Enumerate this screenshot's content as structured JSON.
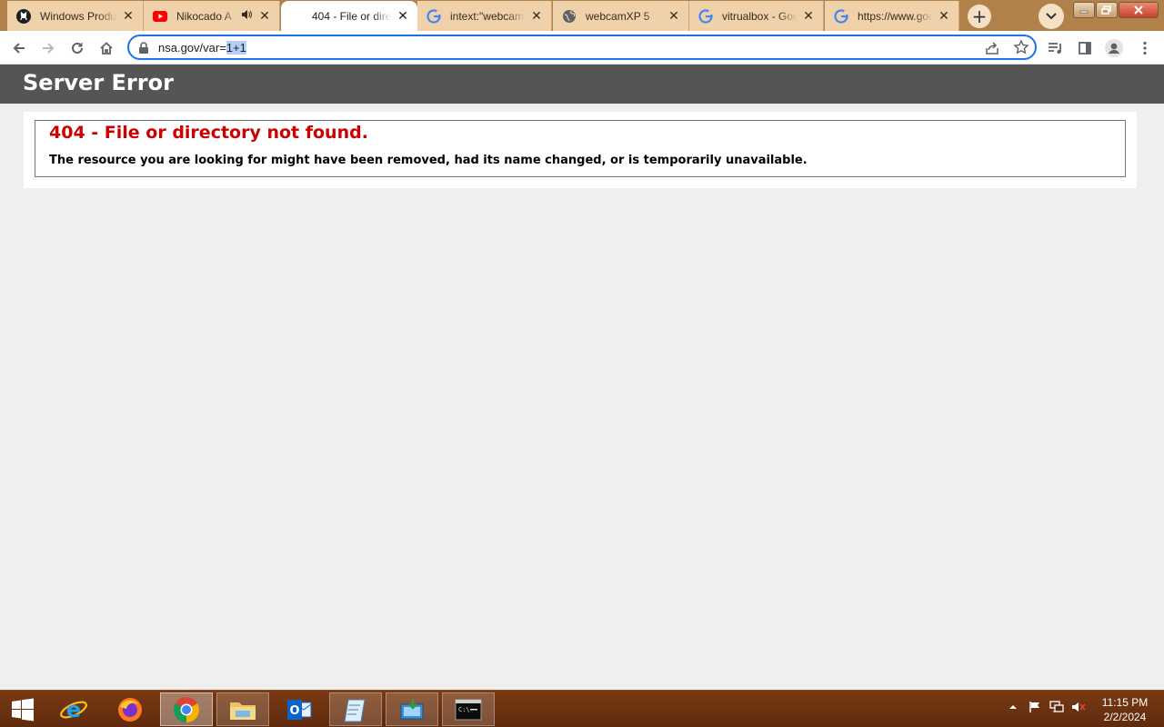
{
  "browser": {
    "tabs": [
      {
        "title": "Windows Produ",
        "icon": "github-icon",
        "state": "inactive"
      },
      {
        "title": "Nikocado A",
        "icon": "youtube-icon",
        "state": "inactive",
        "audio": true
      },
      {
        "title": "404 - File or dire",
        "icon": "none",
        "state": "active"
      },
      {
        "title": "intext:\"webcam",
        "icon": "google-icon",
        "state": "inactive"
      },
      {
        "title": "webcamXP 5",
        "icon": "globe-icon",
        "state": "inactive"
      },
      {
        "title": "vitrualbox - Goo",
        "icon": "google-icon",
        "state": "inactive"
      },
      {
        "title": "https://www.goo",
        "icon": "google-icon",
        "state": "inactive"
      }
    ],
    "address": {
      "url_prefix": "nsa.gov/var=",
      "url_selected": "1+1"
    }
  },
  "page": {
    "header": "Server Error",
    "error_title": "404 - File or directory not found.",
    "error_message": "The resource you are looking for might have been removed, had its name changed, or is temporarily unavailable."
  },
  "taskbar": {
    "apps": [
      "start-icon",
      "internet-explorer-icon",
      "firefox-icon",
      "chrome-icon",
      "file-explorer-icon",
      "outlook-icon",
      "notepad-icon",
      "install-icon",
      "command-prompt-icon"
    ],
    "clock_time": "11:15 PM",
    "clock_date": "2/2/2024"
  },
  "colors": {
    "tabstrip": "#b0824a",
    "tab_inactive": "#f0d2aa",
    "header_bg": "#555555",
    "error_red": "#cc0000",
    "taskbar": "#6a300f",
    "omnibox_focus": "#1a73e8"
  }
}
